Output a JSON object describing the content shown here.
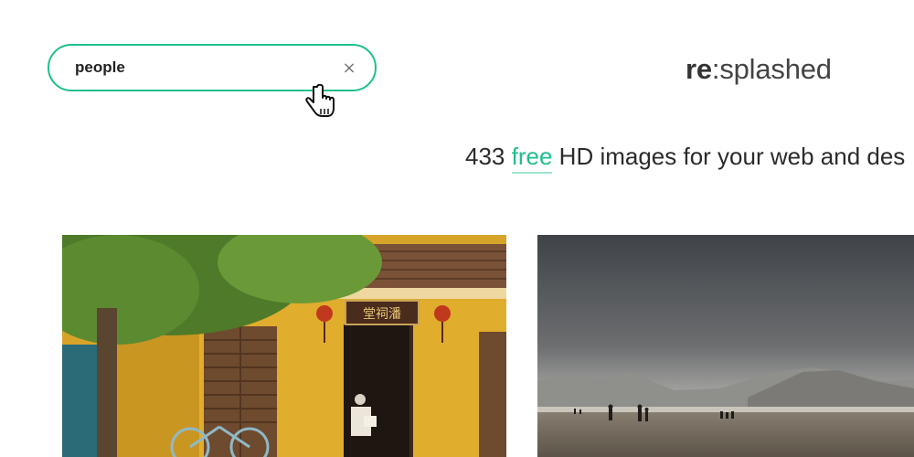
{
  "search": {
    "value": "people",
    "placeholder": "",
    "clear_icon": "×"
  },
  "brand": {
    "logo_bold": "re",
    "logo_colon": ":",
    "logo_light": "splashed"
  },
  "tagline": {
    "count": "433",
    "accent_word": "free",
    "rest": "HD images for your web and des"
  },
  "colors": {
    "accent": "#1fbf8f"
  },
  "photos": [
    {
      "name": "yellow-house-photo",
      "sign_text": "堂祠潘"
    },
    {
      "name": "beach-photo"
    }
  ]
}
